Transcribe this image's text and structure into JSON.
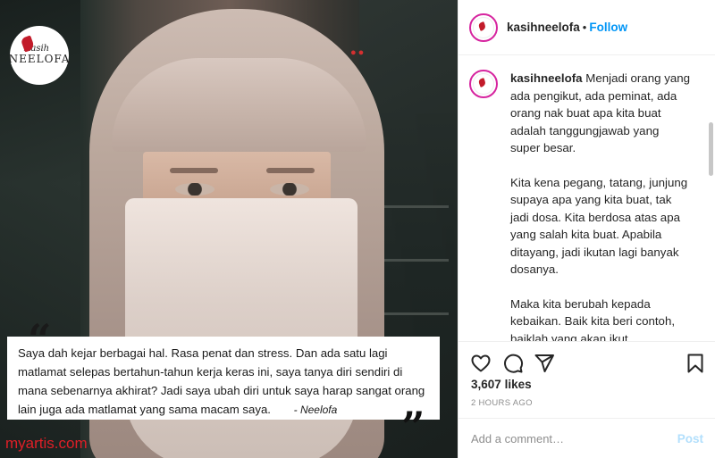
{
  "media": {
    "logo": {
      "script_text": "Kasih",
      "main_text": "NEELOFA"
    },
    "quote": {
      "text": "Saya dah kejar berbagai hal. Rasa penat dan stress. Dan ada satu lagi matlamat selepas bertahun-tahun kerja keras ini, saya tanya diri sendiri di mana sebenarnya akhirat? Jadi saya ubah diri untuk saya harap sangat orang lain juga ada matlamat yang sama macam saya.",
      "author": "- Neelofa",
      "open_mark": "“",
      "close_mark": "”"
    },
    "watermark": "myartis.com"
  },
  "header": {
    "username": "kasihneelofa",
    "separator": "•",
    "follow_label": "Follow"
  },
  "caption": {
    "username": "kasihneelofa",
    "paragraphs": [
      "Menjadi orang yang ada pengikut, ada peminat, ada orang nak buat apa kita buat adalah tanggungjawab yang super besar.",
      "Kita kena pegang, tatang, junjung supaya apa yang kita buat, tak jadi dosa. Kita berdosa atas apa yang salah kita buat. Apabila ditayang, jadi ikutan lagi banyak dosanya.",
      "Maka kita berubah kepada kebaikan. Baik kita beri contoh, baiklah yang akan ikut. #KasihNeelofa sentiasa berharap kita semua mengikuti segala kebaikan, buang keburukan dan hidup bahagia, berjaya dan ceria."
    ],
    "time": "2h"
  },
  "actions": {
    "icons": [
      "heart-icon",
      "comment-icon",
      "share-icon",
      "bookmark-icon"
    ]
  },
  "likes": {
    "count": "3,607",
    "label": "likes"
  },
  "posted_ago": "2 HOURS AGO",
  "comment": {
    "placeholder": "Add a comment…",
    "post_label": "Post"
  },
  "colors": {
    "follow": "#0095f6",
    "post_disabled": "#b2dffc",
    "watermark": "#e01f27",
    "ring": "#d6249f"
  }
}
